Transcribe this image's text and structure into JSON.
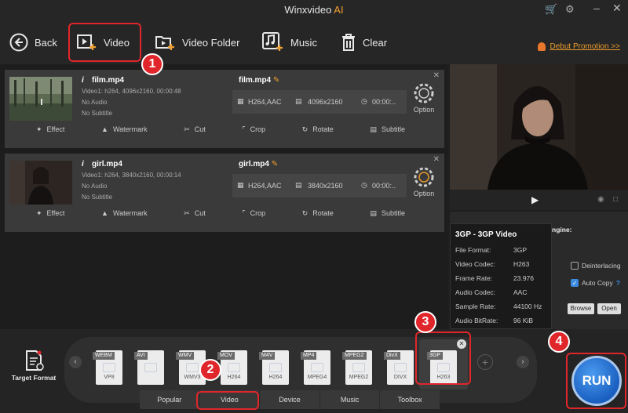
{
  "app": {
    "title": "Winxvideo",
    "title_suffix": "AI"
  },
  "toolbar": {
    "back": "Back",
    "video": "Video",
    "video_folder": "Video Folder",
    "music": "Music",
    "clear": "Clear",
    "promotion": "Debut Promotion >>"
  },
  "files": [
    {
      "name": "film.mp4",
      "stream": "Video1: h264, 4096x2160, 00:00:48",
      "audio": "No Audio",
      "subtitle": "No Subtitle",
      "output_name": "film.mp4",
      "codec": "H264,AAC",
      "resolution": "4096x2160",
      "duration": "00:00:..",
      "option": "Option"
    },
    {
      "name": "girl.mp4",
      "stream": "Video1: h264, 3840x2160, 00:00:14",
      "audio": "No Audio",
      "subtitle": "No Subtitle",
      "output_name": "girl.mp4",
      "codec": "H264,AAC",
      "resolution": "3840x2160",
      "duration": "00:00:..",
      "option": "Option"
    }
  ],
  "edit_tools": {
    "effect": "Effect",
    "watermark": "Watermark",
    "cut": "Cut",
    "crop": "Crop",
    "rotate": "Rotate",
    "subtitle": "Subtitle"
  },
  "tooltip": {
    "title": "3GP - 3GP Video",
    "rows": [
      {
        "label": "File Format:",
        "value": "3GP"
      },
      {
        "label": "Video Codec:",
        "value": "H263"
      },
      {
        "label": "Frame Rate:",
        "value": "23.976"
      },
      {
        "label": "Audio Codec:",
        "value": "AAC"
      },
      {
        "label": "Sample Rate:",
        "value": "44100 Hz"
      },
      {
        "label": "Audio BitRate:",
        "value": "96 KiB"
      }
    ]
  },
  "settings": {
    "engine_label": "ngine:",
    "deinterlacing": "Deinterlacing",
    "auto_copy": "Auto Copy",
    "help": "?",
    "browse": "Browse",
    "open": "Open"
  },
  "target_format_label": "Target Format",
  "formats": [
    {
      "top": "WEBM",
      "bottom": "VP8"
    },
    {
      "top": "AVI",
      "bottom": ""
    },
    {
      "top": "WMV",
      "bottom": "WMV3"
    },
    {
      "top": "MOV",
      "bottom": "H264"
    },
    {
      "top": "M4V",
      "bottom": "H264"
    },
    {
      "top": "MP4",
      "bottom": "MPEG4"
    },
    {
      "top": "MPEG2",
      "bottom": "MPEG2"
    },
    {
      "top": "DivX",
      "bottom": "DIVX"
    },
    {
      "top": "3GP",
      "bottom": "H263"
    }
  ],
  "tabs": [
    "Popular",
    "Video",
    "Device",
    "Music",
    "Toolbox"
  ],
  "run": "RUN",
  "badges": [
    "1",
    "2",
    "3",
    "4"
  ],
  "colors": {
    "highlight": "#e0262b",
    "accent": "#f0a030",
    "run": "#1a5fc0"
  }
}
